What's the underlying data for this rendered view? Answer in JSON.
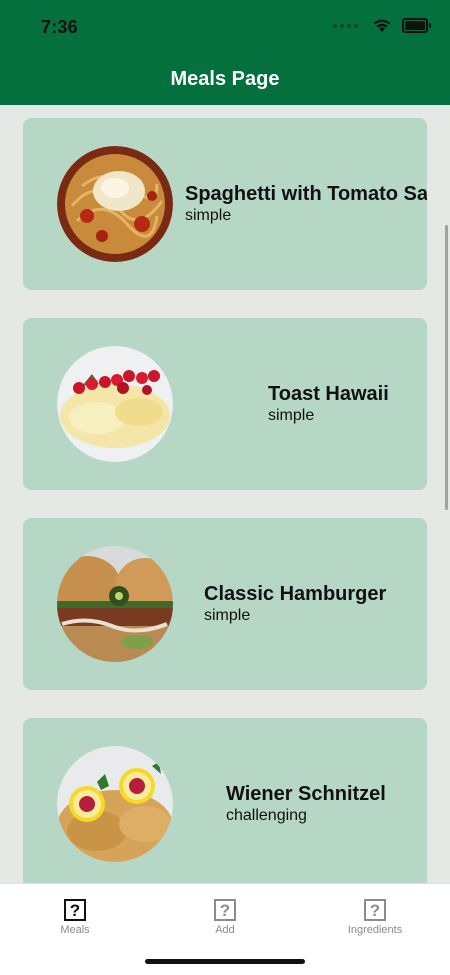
{
  "status_bar": {
    "time": "7:36"
  },
  "header": {
    "title": "Meals Page"
  },
  "meals": [
    {
      "title": "Spaghetti with Tomato Sauce",
      "complexity": "simple",
      "image_icon": "spaghetti-image"
    },
    {
      "title": "Toast Hawaii",
      "complexity": "simple",
      "image_icon": "toast-image"
    },
    {
      "title": "Classic Hamburger",
      "complexity": "simple",
      "image_icon": "hamburger-image"
    },
    {
      "title": "Wiener Schnitzel",
      "complexity": "challenging",
      "image_icon": "schnitzel-image"
    }
  ],
  "tabs": [
    {
      "label": "Meals",
      "icon": "?",
      "active": true
    },
    {
      "label": "Add",
      "icon": "?",
      "active": false
    },
    {
      "label": "Ingredients",
      "icon": "?",
      "active": false
    }
  ],
  "colors": {
    "header": "#04703d",
    "card": "#b6d7c5",
    "background": "#e4e9e6"
  }
}
